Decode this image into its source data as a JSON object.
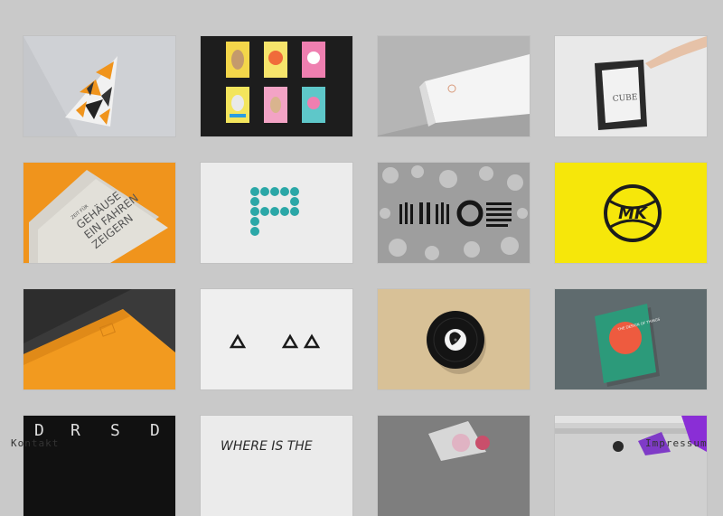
{
  "footer": {
    "kontakt_label": "Kontakt",
    "impressum_label": "Impressum"
  },
  "tiles": {
    "r1c1": {
      "name": "geometric-triangle-logo-cover"
    },
    "r1c2": {
      "name": "poster-series-six-prints"
    },
    "r1c3": {
      "name": "white-box-packaging"
    },
    "r1c4": {
      "name": "framed-artwork"
    },
    "r2c1": {
      "name": "orange-print-cards",
      "lines": [
        "GEHÄUSE",
        "EIN FAHREN",
        "ZEIGERN"
      ],
      "small": "ZEIT FÜR"
    },
    "r2c2": {
      "name": "dotted-p-logo"
    },
    "r2c3": {
      "name": "stone-texture-lettering"
    },
    "r2c4": {
      "name": "mk-tennis-logo",
      "text": "MK"
    },
    "r3c1": {
      "name": "orange-envelope"
    },
    "r3c2": {
      "name": "triangle-logo-on-paper"
    },
    "r3c3": {
      "name": "vinyl-record"
    },
    "r3c4": {
      "name": "green-book-cover",
      "title": "THE DESIGN OF THINGS"
    },
    "r4c1": {
      "name": "drsd-black-tile",
      "letters": [
        "D",
        "R",
        "S",
        "D"
      ]
    },
    "r4c2": {
      "name": "typography-poster",
      "text": "WHERE IS THE"
    },
    "r4c3": {
      "name": "abstract-shapes-print"
    },
    "r4c4": {
      "name": "purple-abstract-street"
    }
  },
  "colors": {
    "background": "#c9c9c9",
    "orange": "#f0941c",
    "yellow": "#f6e70a",
    "teal": "#2ba7a7",
    "pink": "#ee6fa6"
  }
}
